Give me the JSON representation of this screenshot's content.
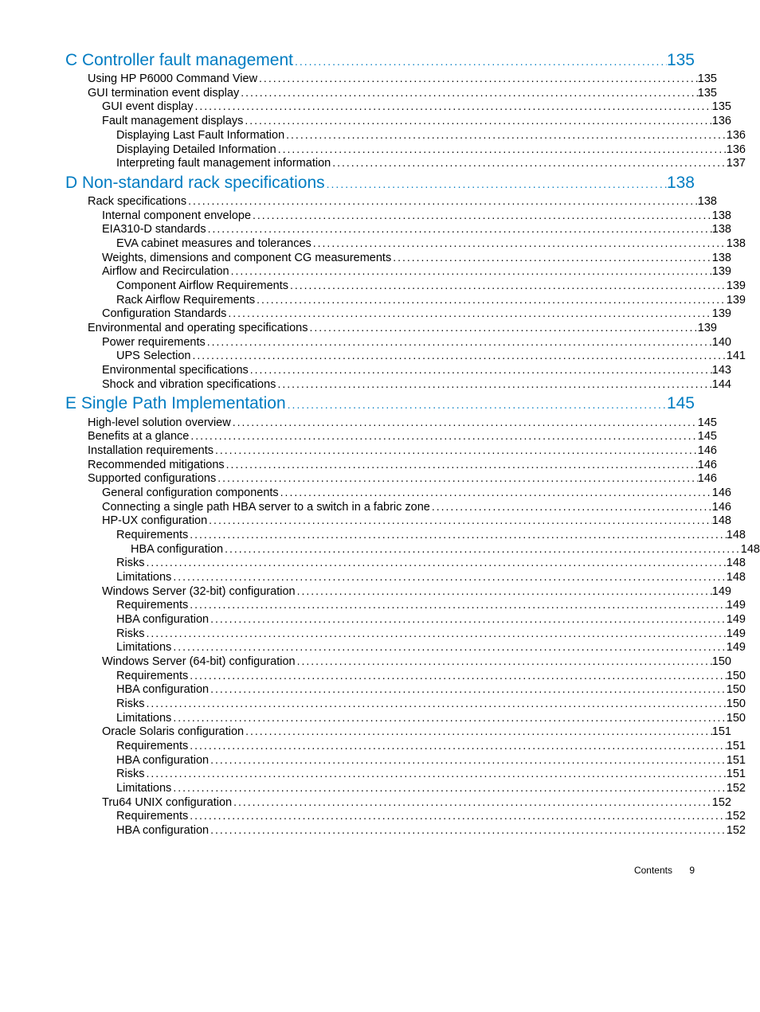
{
  "toc": [
    {
      "level": "h",
      "title": "C Controller fault management",
      "page": "135"
    },
    {
      "level": "1",
      "title": "Using HP P6000 Command View",
      "page": "135"
    },
    {
      "level": "1",
      "title": "GUI termination event display",
      "page": "135"
    },
    {
      "level": "2",
      "title": "GUI event display",
      "page": "135"
    },
    {
      "level": "2",
      "title": "Fault management displays",
      "page": "136"
    },
    {
      "level": "3",
      "title": "Displaying Last Fault Information",
      "page": "136"
    },
    {
      "level": "3",
      "title": "Displaying Detailed Information",
      "page": "136"
    },
    {
      "level": "3",
      "title": "Interpreting fault management information",
      "page": "137"
    },
    {
      "level": "h",
      "title": "D Non-standard rack specifications",
      "page": "138"
    },
    {
      "level": "1",
      "title": "Rack specifications",
      "page": "138"
    },
    {
      "level": "2",
      "title": "Internal component envelope",
      "page": "138"
    },
    {
      "level": "2",
      "title": "EIA310-D standards",
      "page": "138"
    },
    {
      "level": "3",
      "title": "EVA cabinet measures and tolerances",
      "page": "138"
    },
    {
      "level": "2",
      "title": "Weights, dimensions and component CG measurements",
      "page": "138"
    },
    {
      "level": "2",
      "title": "Airflow and Recirculation",
      "page": "139"
    },
    {
      "level": "3",
      "title": "Component Airflow Requirements",
      "page": "139"
    },
    {
      "level": "3",
      "title": "Rack Airflow Requirements",
      "page": "139"
    },
    {
      "level": "2",
      "title": "Configuration Standards",
      "page": "139"
    },
    {
      "level": "1",
      "title": "Environmental and operating specifications",
      "page": "139"
    },
    {
      "level": "2",
      "title": "Power requirements",
      "page": "140"
    },
    {
      "level": "3",
      "title": "UPS Selection",
      "page": "141"
    },
    {
      "level": "2",
      "title": "Environmental specifications",
      "page": "143"
    },
    {
      "level": "2",
      "title": "Shock and vibration specifications",
      "page": "144"
    },
    {
      "level": "h",
      "title": "E Single Path Implementation",
      "page": "145"
    },
    {
      "level": "1",
      "title": "High-level solution overview",
      "page": "145"
    },
    {
      "level": "1",
      "title": "Benefits at a glance",
      "page": "145"
    },
    {
      "level": "1",
      "title": "Installation requirements",
      "page": "146"
    },
    {
      "level": "1",
      "title": "Recommended mitigations",
      "page": "146"
    },
    {
      "level": "1",
      "title": "Supported configurations",
      "page": "146"
    },
    {
      "level": "2",
      "title": "General configuration components",
      "page": "146"
    },
    {
      "level": "2",
      "title": "Connecting a single path HBA server to a switch in a fabric zone",
      "page": "146"
    },
    {
      "level": "2",
      "title": "HP-UX configuration",
      "page": "148"
    },
    {
      "level": "3",
      "title": "Requirements",
      "page": "148"
    },
    {
      "level": "4",
      "title": "HBA configuration",
      "page": "148"
    },
    {
      "level": "3",
      "title": "Risks",
      "page": "148"
    },
    {
      "level": "3",
      "title": "Limitations",
      "page": "148"
    },
    {
      "level": "2",
      "title": "Windows Server (32-bit) configuration",
      "page": "149"
    },
    {
      "level": "3",
      "title": "Requirements",
      "page": "149"
    },
    {
      "level": "3",
      "title": "HBA configuration",
      "page": "149"
    },
    {
      "level": "3",
      "title": "Risks",
      "page": "149"
    },
    {
      "level": "3",
      "title": "Limitations",
      "page": "149"
    },
    {
      "level": "2",
      "title": "Windows Server (64-bit) configuration",
      "page": "150"
    },
    {
      "level": "3",
      "title": "Requirements",
      "page": "150"
    },
    {
      "level": "3",
      "title": "HBA configuration",
      "page": "150"
    },
    {
      "level": "3",
      "title": "Risks",
      "page": "150"
    },
    {
      "level": "3",
      "title": "Limitations",
      "page": "150"
    },
    {
      "level": "2",
      "title": "Oracle Solaris configuration",
      "page": "151"
    },
    {
      "level": "3",
      "title": "Requirements",
      "page": "151"
    },
    {
      "level": "3",
      "title": "HBA configuration",
      "page": "151"
    },
    {
      "level": "3",
      "title": "Risks",
      "page": "151"
    },
    {
      "level": "3",
      "title": "Limitations",
      "page": "152"
    },
    {
      "level": "2",
      "title": "Tru64 UNIX configuration",
      "page": "152"
    },
    {
      "level": "3",
      "title": "Requirements",
      "page": "152"
    },
    {
      "level": "3",
      "title": "HBA configuration",
      "page": "152"
    }
  ],
  "footer": {
    "label": "Contents",
    "page": "9"
  }
}
